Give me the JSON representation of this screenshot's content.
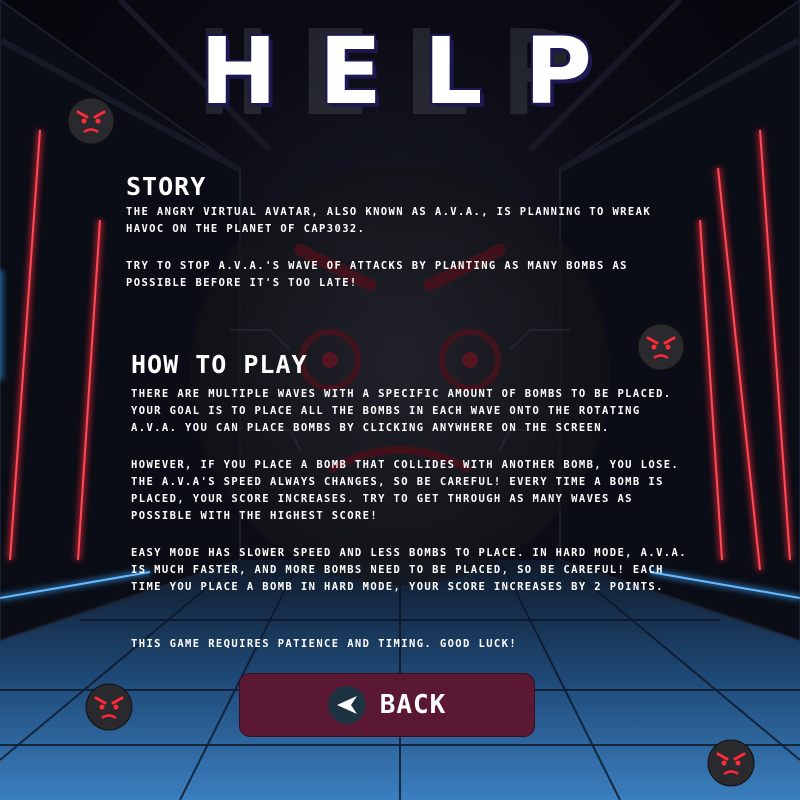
{
  "title": "HELP",
  "title_ghost": "HELP",
  "story": {
    "heading": "STORY",
    "paragraphs": [
      "The angry virtual avatar, also known as A.V.A., is planning to wreak havoc on the planet of CAP3032.",
      "Try to stop A.V.A.'s wave of attacks by planting as many bombs as possible before it's too late!"
    ]
  },
  "how_to_play": {
    "heading": "HOW TO PLAY",
    "paragraphs": [
      "There are multiple waves with a specific amount of bombs to be placed. Your goal is to place all the bombs in each wave onto the rotating A.V.A. You can place bombs by clicking anywhere on the screen.",
      "However, if you place a bomb that collides with another bomb, you lose. The A.V.A's speed always changes, so be careful! Every time a bomb is placed, your score increases. Try to get through as many waves as possible with the highest score!",
      "Easy mode has slower speed and less bombs to place. In hard mode, A.V.A. is much faster, and more bombs need to be placed, so be careful! Each time you place a bomb in hard mode, your score increases by 2 points.",
      "This game requires patience and timing. Good luck!"
    ]
  },
  "back_button": {
    "label": "BACK",
    "icon": "arrow-left-icon"
  },
  "decorations": {
    "emoji_icon": "angry-face-icon"
  },
  "colors": {
    "neon_red": "#ff2a3a",
    "neon_blue": "#3aa4ff",
    "button_bg": "#5b1832",
    "title_shadow": "#1c1850"
  }
}
